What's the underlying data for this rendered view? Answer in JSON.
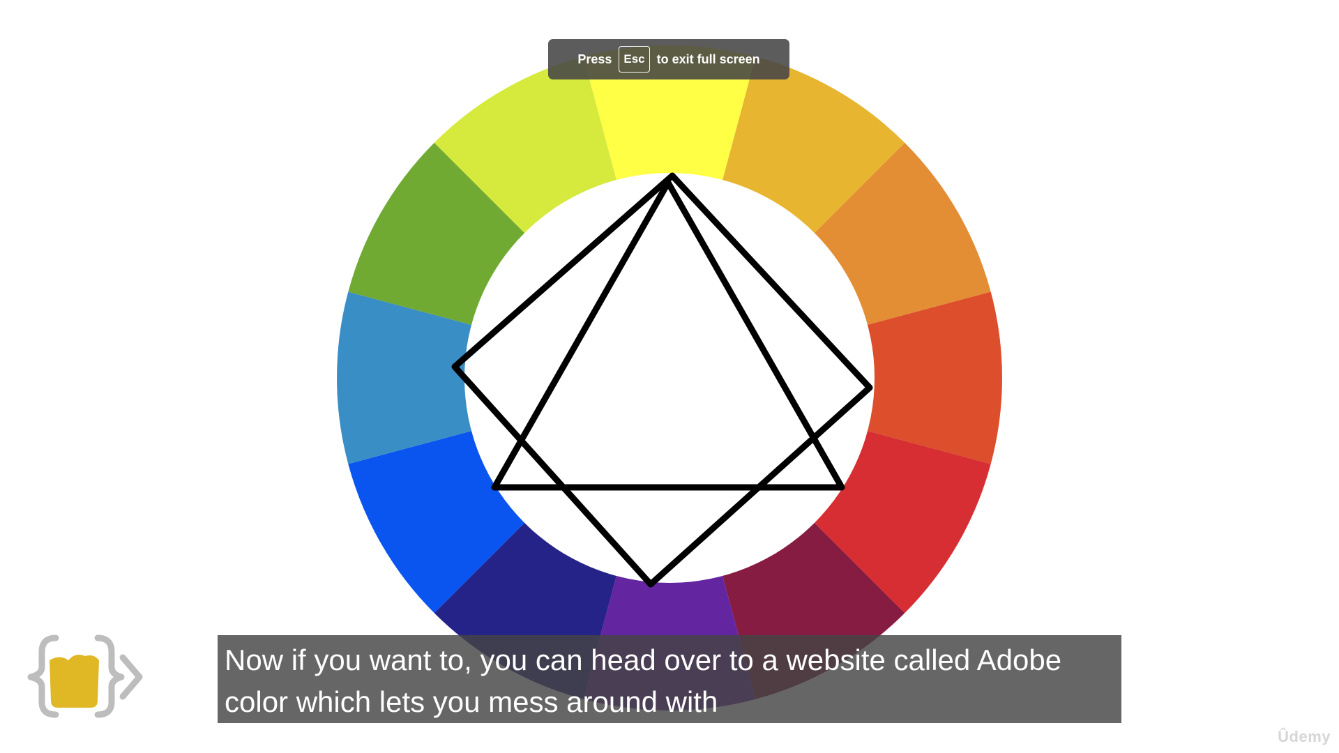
{
  "video_frame": {
    "fullscreen_notice": {
      "prefix": "Press",
      "key": "Esc",
      "suffix": "to exit full screen"
    },
    "color_wheel": {
      "segment_colors": [
        "#FFFF45",
        "#E8B530",
        "#E38E35",
        "#DC4E2C",
        "#D72E33",
        "#871C42",
        "#6425A1",
        "#252288",
        "#0A55F0",
        "#3A8EC6",
        "#70AA33",
        "#D6EA3D"
      ],
      "shapes": [
        "triangle",
        "square"
      ],
      "stroke_color": "#000000"
    },
    "subtitle": {
      "line1": "Now if you want to, you can head over to a website called Adobe",
      "line2": "color which lets you mess around with"
    },
    "logo": {
      "icon": "curly-braces-cup-logo",
      "accent_color": "#E0B825",
      "frame_color": "#BDBDBD"
    },
    "watermark": "Ûdemy"
  }
}
